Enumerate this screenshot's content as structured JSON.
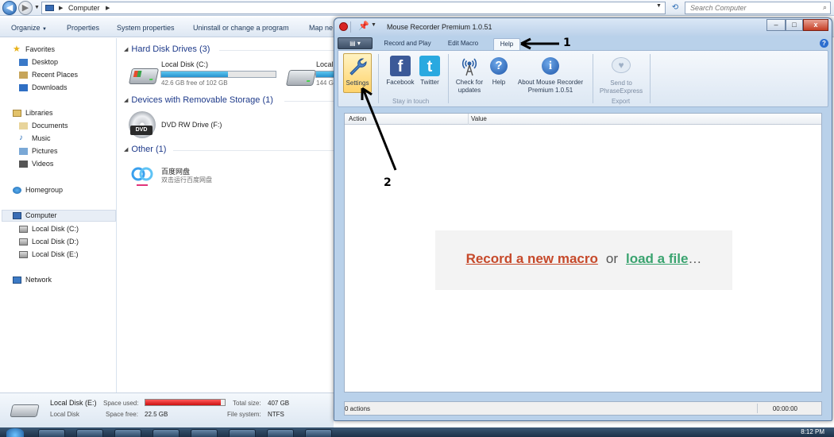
{
  "explorer": {
    "address": {
      "path": "Computer"
    },
    "search": {
      "placeholder": "Search Computer"
    },
    "commands": [
      "Organize",
      "Properties",
      "System properties",
      "Uninstall or change a program",
      "Map ne"
    ],
    "nav": {
      "favorites": "Favorites",
      "fav_items": [
        "Desktop",
        "Recent Places",
        "Downloads"
      ],
      "libraries": "Libraries",
      "lib_items": [
        "Documents",
        "Music",
        "Pictures",
        "Videos"
      ],
      "homegroup": "Homegroup",
      "computer": "Computer",
      "computer_items": [
        "Local Disk (C:)",
        "Local Disk (D:)",
        "Local Disk (E:)"
      ],
      "network": "Network"
    },
    "groups": {
      "hdd": "Hard Disk Drives (3)",
      "removable": "Devices with Removable Storage (1)",
      "other": "Other (1)"
    },
    "drive_c": {
      "name": "Local Disk (C:)",
      "free_text": "42.6 GB free of 102 GB",
      "used_fraction": 0.58
    },
    "drive_d": {
      "name": "Local",
      "free_text": "144 G",
      "used_fraction": 0.55
    },
    "dvd": {
      "name": "DVD RW Drive (F:)",
      "icon_text": "DVD"
    },
    "baidu": {
      "name": "百度网盘",
      "sub": "双击运行百度网盘"
    },
    "details": {
      "drive_name": "Local Disk (E:)",
      "drive_type": "Local Disk",
      "space_used_label": "Space used:",
      "space_free_label": "Space free:",
      "space_free": "22.5 GB",
      "total_size_label": "Total size:",
      "total_size": "407 GB",
      "fs_label": "File system:",
      "fs": "NTFS",
      "used_fraction": 0.95
    },
    "taskbar": {
      "clock": "8:12 PM"
    }
  },
  "mouse_recorder": {
    "title": "Mouse Recorder Premium 1.0.51",
    "window_controls": {
      "minimize": "–",
      "maximize": "□",
      "close": "x"
    },
    "tabs": [
      "Record and Play",
      "Edit Macro",
      "Help"
    ],
    "active_tab": "Help",
    "ribbon": {
      "settings": "Settings",
      "facebook": "Facebook",
      "twitter": "Twitter",
      "stay_in_touch": "Stay in touch",
      "check_updates_1": "Check for",
      "check_updates_2": "updates",
      "help": "Help",
      "about_1": "About Mouse Recorder",
      "about_2": "Premium 1.0.51",
      "send_1": "Send to",
      "send_2": "PhraseExpress",
      "export": "Export"
    },
    "grid": {
      "col_action": "Action",
      "col_value": "Value"
    },
    "empty": {
      "record": "Record a new macro",
      "or": "or",
      "load": "load a file",
      "ellipsis": "…"
    },
    "status": {
      "actions": "0 actions",
      "time": "00:00:00"
    }
  },
  "annotations": {
    "label_1": "1",
    "label_2": "2"
  },
  "colors": {
    "record_link": "#c6492a",
    "load_link": "#3aa36f",
    "facebook": "#3b5998",
    "twitter": "#2aa9e0"
  }
}
